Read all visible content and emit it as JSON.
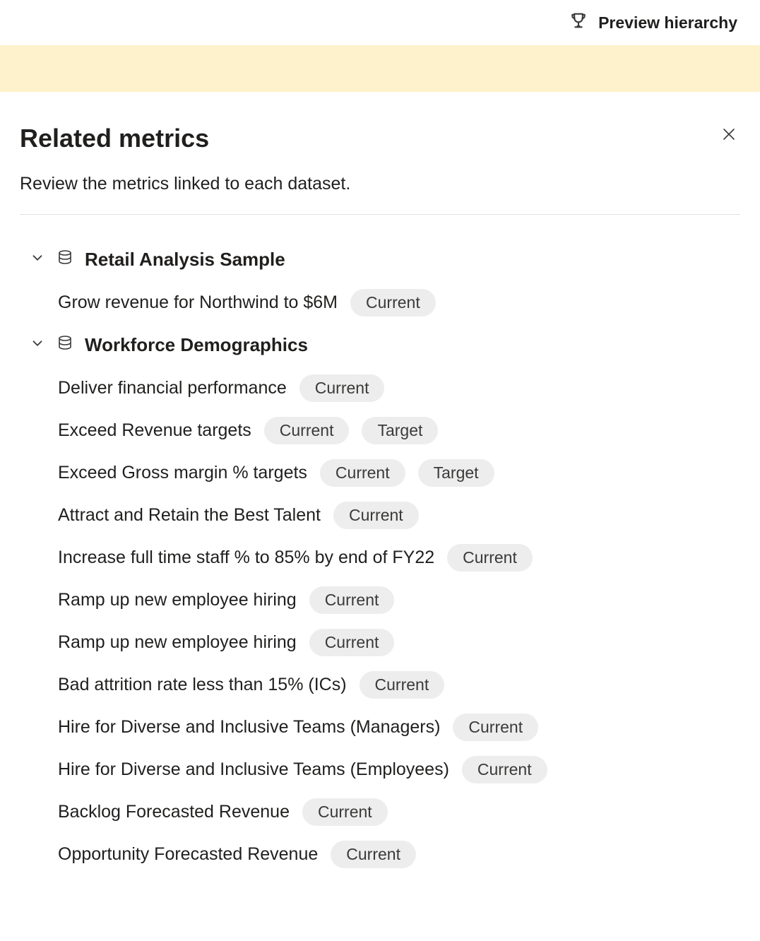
{
  "topbar": {
    "preview_label": "Preview hierarchy"
  },
  "panel": {
    "title": "Related metrics",
    "subtitle": "Review the metrics linked to each dataset."
  },
  "groups": [
    {
      "name": "Retail Analysis Sample",
      "items": [
        {
          "label": "Grow revenue for Northwind to $6M",
          "tags": [
            "Current"
          ]
        }
      ]
    },
    {
      "name": "Workforce Demographics",
      "items": [
        {
          "label": "Deliver financial performance",
          "tags": [
            "Current"
          ]
        },
        {
          "label": "Exceed Revenue targets",
          "tags": [
            "Current",
            "Target"
          ]
        },
        {
          "label": "Exceed Gross margin % targets",
          "tags": [
            "Current",
            "Target"
          ]
        },
        {
          "label": "Attract and Retain the Best Talent",
          "tags": [
            "Current"
          ]
        },
        {
          "label": "Increase full time staff % to 85% by end of FY22",
          "tags": [
            "Current"
          ]
        },
        {
          "label": "Ramp up new employee hiring",
          "tags": [
            "Current"
          ]
        },
        {
          "label": "Ramp up new employee hiring",
          "tags": [
            "Current"
          ]
        },
        {
          "label": "Bad attrition rate less than 15% (ICs)",
          "tags": [
            "Current"
          ]
        },
        {
          "label": "Hire for Diverse and Inclusive Teams (Managers)",
          "tags": [
            "Current"
          ]
        },
        {
          "label": "Hire for Diverse and Inclusive Teams (Employees)",
          "tags": [
            "Current"
          ]
        },
        {
          "label": "Backlog Forecasted Revenue",
          "tags": [
            "Current"
          ]
        },
        {
          "label": "Opportunity Forecasted Revenue",
          "tags": [
            "Current"
          ]
        }
      ]
    }
  ]
}
